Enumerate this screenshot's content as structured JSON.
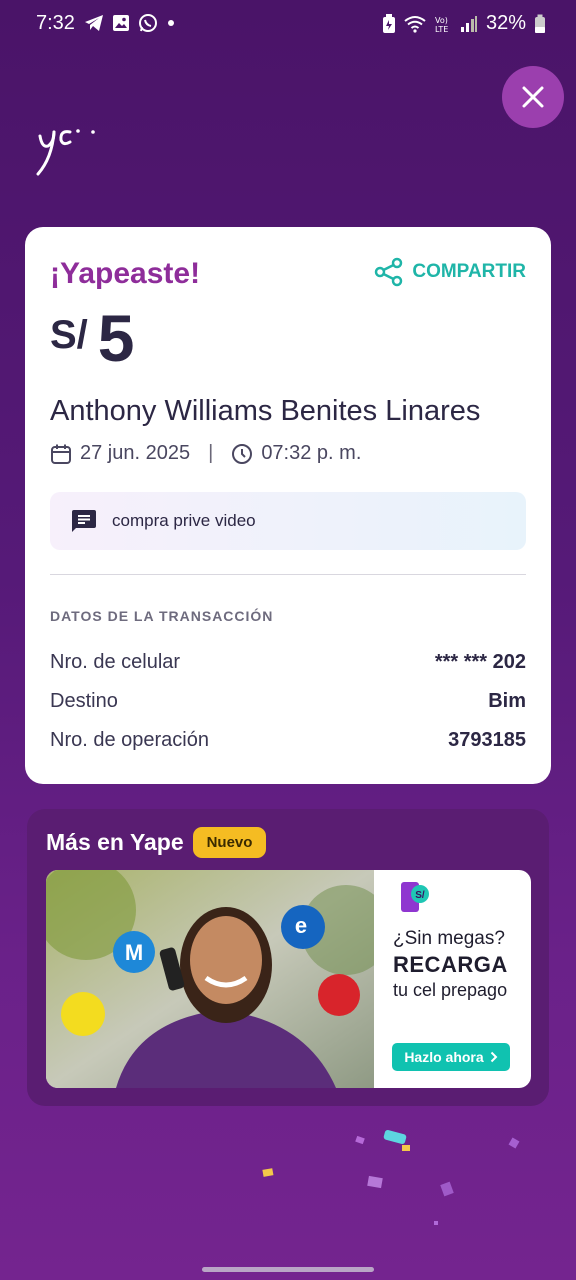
{
  "status_bar": {
    "time": "7:32",
    "battery": "32%",
    "left_icons": [
      "telegram-icon",
      "gallery-icon",
      "whatsapp-icon",
      "dot-icon"
    ],
    "right_icons": [
      "battery-saver-icon",
      "wifi-icon",
      "volte-icon",
      "signal-icon",
      "battery-icon"
    ]
  },
  "receipt": {
    "title": "¡Yapeaste!",
    "share_label": "COMPARTIR",
    "currency": "S/",
    "amount": "5",
    "recipient": "Anthony Williams Benites Linares",
    "date": "27 jun. 2025",
    "separator": "|",
    "time": "07:32 p. m.",
    "note": "compra prive video",
    "section_title": "DATOS DE LA TRANSACCIÓN",
    "details": [
      {
        "label": "Nro. de celular",
        "value": "*** *** 202"
      },
      {
        "label": "Destino",
        "value": "Bim"
      },
      {
        "label": "Nro. de operación",
        "value": "3793185"
      }
    ]
  },
  "more": {
    "title": "Más en Yape",
    "badge": "Nuevo",
    "banner": {
      "line1": "¿Sin megas?",
      "line2": "RECARGA",
      "line3": "tu cel prepago",
      "button": "Hazlo ahora",
      "button_icon": "chevron-right-icon",
      "operators": [
        "movistar",
        "entel",
        "claro",
        "bitel"
      ]
    }
  },
  "colors": {
    "accent_purple": "#8e2d9a",
    "teal": "#1fb5a8",
    "badge_yellow": "#f5bc22"
  }
}
